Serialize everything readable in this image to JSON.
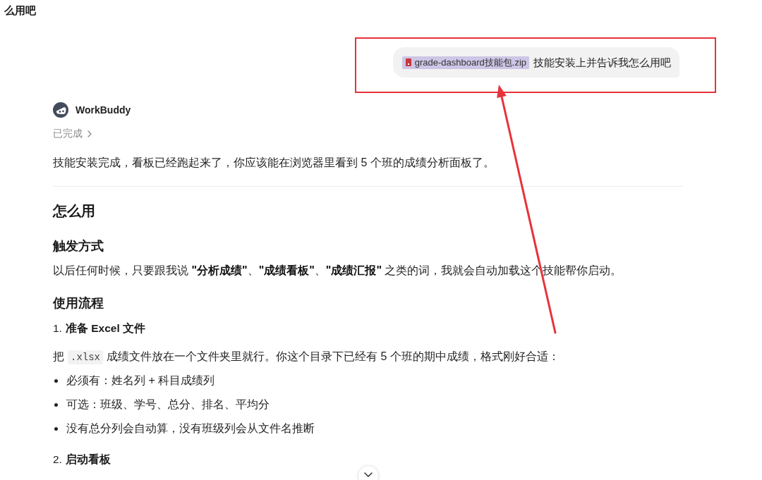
{
  "header": {
    "title": "么用吧"
  },
  "user_message": {
    "attachment": {
      "name": "grade-dashboard技能包.zip"
    },
    "text": "技能安装上并告诉我怎么用吧"
  },
  "assistant": {
    "name": "WorkBuddy",
    "status": {
      "text": "已完成",
      "expanded": false
    },
    "blocks": [
      {
        "kind": "paragraph",
        "parts": [
          {
            "kind": "text",
            "text": "技能安装完成，看板已经跑起来了，你应该能在浏览器里看到 5 个班的成绩分析面板了。"
          }
        ]
      },
      {
        "kind": "divider"
      },
      {
        "kind": "h2",
        "text": "怎么用"
      },
      {
        "kind": "h3",
        "text": "触发方式"
      },
      {
        "kind": "paragraph",
        "parts": [
          {
            "kind": "text",
            "text": "以后任何时候，只要跟我说 **\"分析成绩\"**、**\"成绩看板\"**、**\"成绩汇报\"** 之类的词，我就会自动加载这个技能帮你启动。"
          }
        ]
      },
      {
        "kind": "h3",
        "text": "使用流程"
      },
      {
        "kind": "step",
        "number": "1.",
        "text": "准备 Excel 文件"
      },
      {
        "kind": "paragraph",
        "parts": [
          {
            "kind": "text",
            "text": "把"
          },
          {
            "kind": "code",
            "text": ".xlsx"
          },
          {
            "kind": "text",
            "text": "成绩文件放在一个文件夹里就行。你这个目录下已经有 5 个班的期中成绩，格式刚好合适："
          }
        ]
      },
      {
        "kind": "bullets",
        "items": [
          "必须有：姓名列 + 科目成绩列",
          "可选：班级、学号、总分、排名、平均分",
          "没有总分列会自动算，没有班级列会从文件名推断"
        ]
      },
      {
        "kind": "step",
        "number": "2.",
        "text": "启动看板"
      }
    ]
  },
  "scroll_down_button": true,
  "annotations": {
    "highlight_frame": true,
    "arrow": true
  }
}
